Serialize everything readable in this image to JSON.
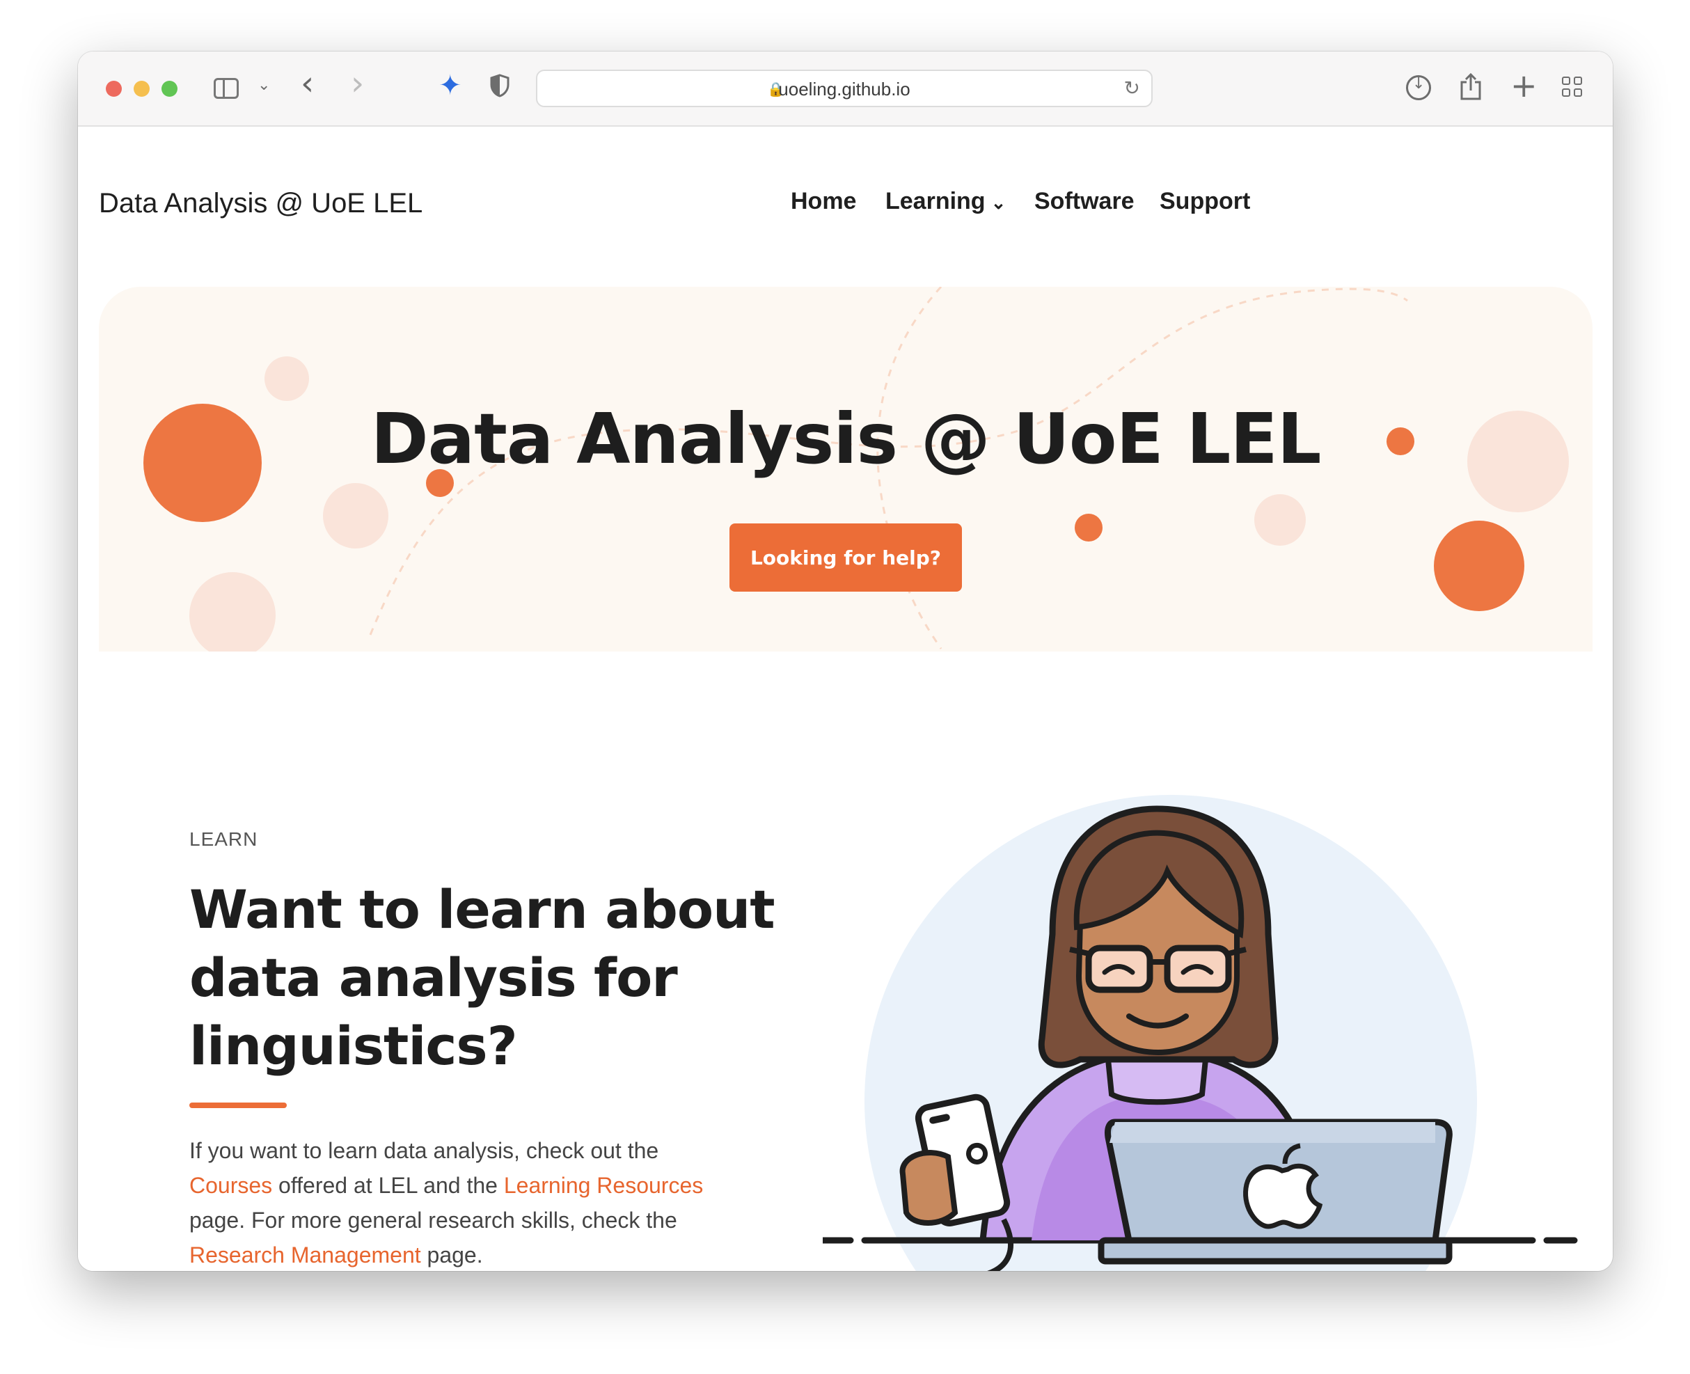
{
  "browser": {
    "url": "uoeling.github.io"
  },
  "site": {
    "brand": "Data Analysis @ UoE LEL",
    "nav": {
      "home": "Home",
      "learning": "Learning",
      "software": "Software",
      "support": "Support"
    }
  },
  "hero": {
    "title": "Data Analysis @ UoE LEL",
    "button": "Looking for help?"
  },
  "learn": {
    "eyebrow": "LEARN",
    "title": "Want to learn about data analysis for linguistics?",
    "text_1": "If you want to learn data analysis, check out the ",
    "link_courses": "Courses",
    "text_2": " offered at LEL and the ",
    "link_resources": "Learning Resources",
    "text_3": " page. For more general research skills, check the ",
    "link_research": "Research Management",
    "text_4": " page."
  },
  "colors": {
    "accent": "#ec6d37",
    "hero_bg": "#fdf8f2",
    "pale_circle": "#fae4da"
  }
}
